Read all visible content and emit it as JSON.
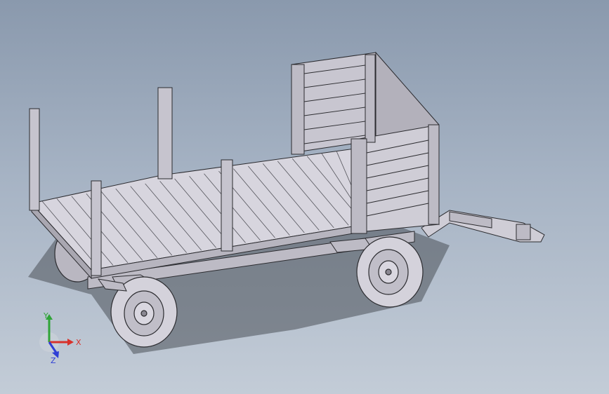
{
  "viewport": {
    "background_top": "#8a99ad",
    "background_bottom": "#c3ccd7"
  },
  "model": {
    "description_icon": "hay-wagon-3d-model",
    "body_color": "#cfcdd6",
    "edge_color": "#2b2b2f",
    "shadow_color": "#4a5058"
  },
  "triad": {
    "x_label": "X",
    "y_label": "Y",
    "z_label": "Z",
    "x_color": "#d8312b",
    "y_color": "#2fa437",
    "z_color": "#2f3fd6"
  }
}
